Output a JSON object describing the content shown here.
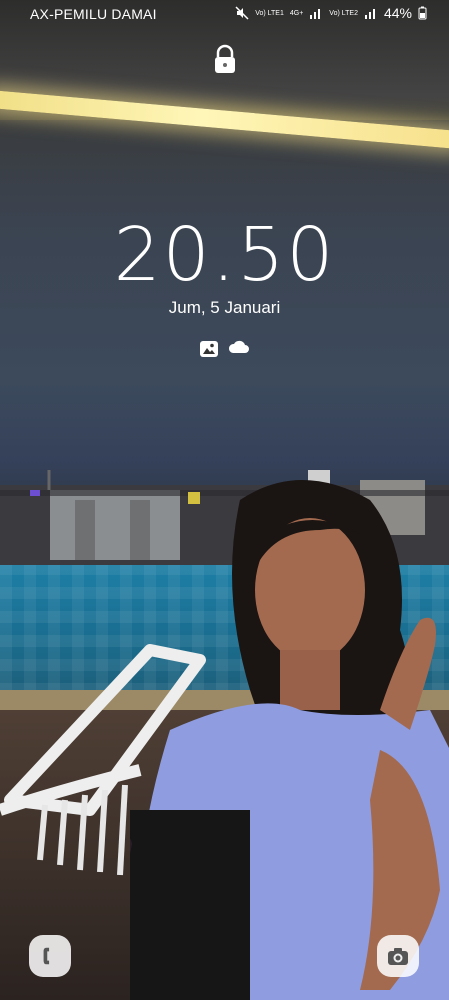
{
  "status_bar": {
    "carrier": "AX-PEMILU DAMAI",
    "sim1": "Vo) LTE1",
    "network": "4G+",
    "sim2": "Vo) LTE2",
    "battery": "44%"
  },
  "lock_screen": {
    "time": "20.50",
    "date": "Jum, 5 Januari",
    "notification_icons": [
      "gallery-icon",
      "cloud-icon"
    ]
  },
  "shortcuts": {
    "left": "phone-icon",
    "right": "camera-icon"
  }
}
